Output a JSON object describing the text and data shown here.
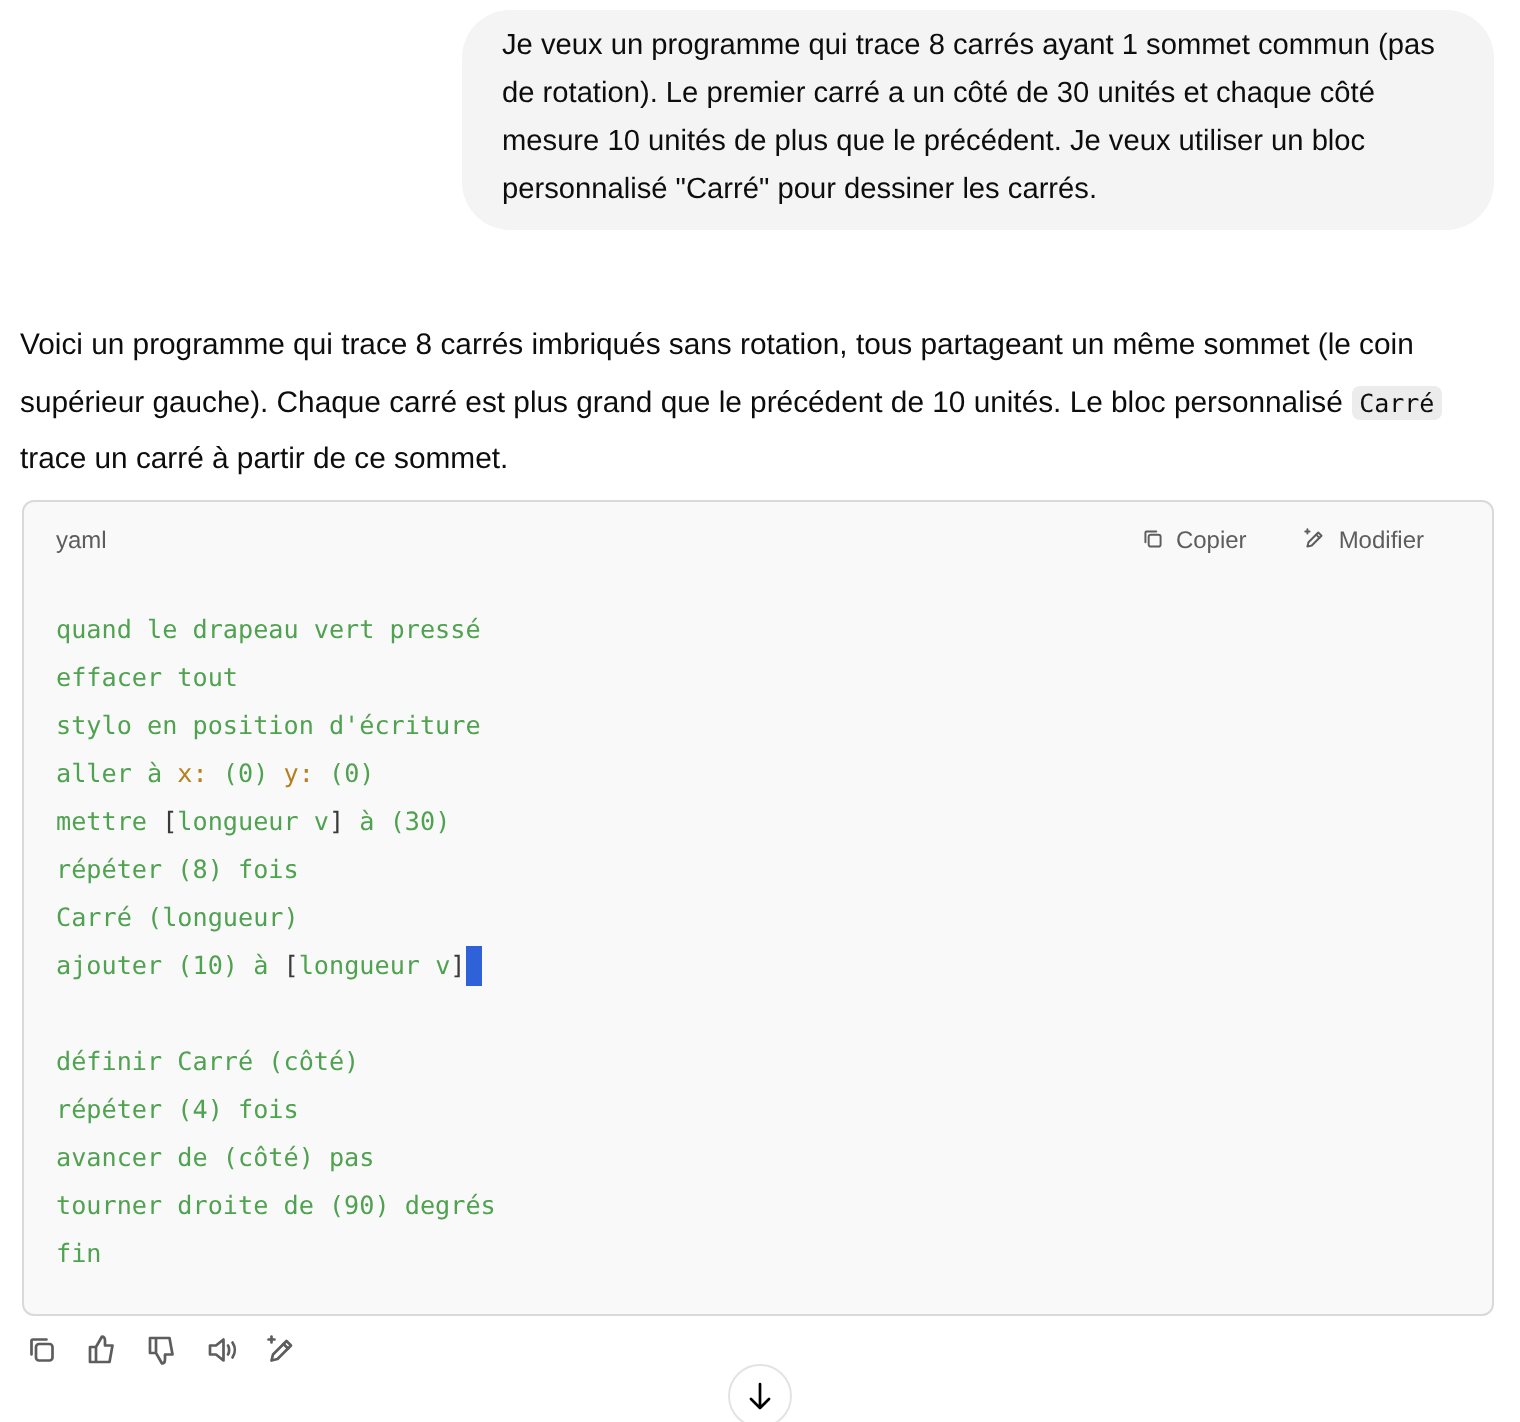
{
  "user_message": {
    "text": "Je veux un programme qui trace 8 carrés ayant 1 sommet commun (pas de rotation). Le premier carré a un côté de 30 unités et chaque côté mesure 10 unités de plus que le précédent. Je veux utiliser un bloc personnalisé \"Carré\" pour dessiner les carrés."
  },
  "reply": {
    "paragraph": [
      {
        "kind": "text",
        "text": "Voici un programme qui trace 8 carrés imbriqués sans rotation, tous partageant un même sommet (le coin supérieur gauche). Chaque carré est plus grand que le précédent de 10 unités. Le bloc personnalisé "
      },
      {
        "kind": "code",
        "text": "Carré"
      },
      {
        "kind": "text",
        "text": " trace un carré à partir de ce sommet."
      }
    ],
    "code_block": {
      "language": "yaml",
      "actions": [
        {
          "kind": "copy",
          "label": "Copier"
        },
        {
          "kind": "edit",
          "label": "Modifier"
        }
      ],
      "lines": [
        {
          "kind": "code",
          "segments": [
            {
              "kind": "text",
              "text": "quand le drapeau vert pressé"
            }
          ]
        },
        {
          "kind": "code",
          "segments": [
            {
              "kind": "text",
              "text": "effacer tout"
            }
          ]
        },
        {
          "kind": "code",
          "segments": [
            {
              "kind": "text",
              "text": "stylo en position d'écriture"
            }
          ]
        },
        {
          "kind": "code",
          "segments": [
            {
              "kind": "text",
              "text": "aller à "
            },
            {
              "kind": "attr",
              "text": "x:"
            },
            {
              "kind": "text",
              "text": " (0) "
            },
            {
              "kind": "attr",
              "text": "y:"
            },
            {
              "kind": "text",
              "text": " (0)"
            }
          ]
        },
        {
          "kind": "code",
          "segments": [
            {
              "kind": "text",
              "text": "mettre "
            },
            {
              "kind": "bracket",
              "text": "["
            },
            {
              "kind": "text",
              "text": "longueur v"
            },
            {
              "kind": "bracket",
              "text": "]"
            },
            {
              "kind": "text",
              "text": " à (30)"
            }
          ]
        },
        {
          "kind": "code",
          "segments": [
            {
              "kind": "text",
              "text": "répéter (8) fois"
            }
          ]
        },
        {
          "kind": "code",
          "segments": [
            {
              "kind": "text",
              "text": "Carré (longueur)"
            }
          ]
        },
        {
          "kind": "code",
          "cursor": true,
          "segments": [
            {
              "kind": "text",
              "text": "ajouter (10) à "
            },
            {
              "kind": "bracket",
              "text": "["
            },
            {
              "kind": "text",
              "text": "longueur v"
            },
            {
              "kind": "bracket",
              "text": "]"
            }
          ]
        },
        {
          "kind": "blank"
        },
        {
          "kind": "code",
          "segments": [
            {
              "kind": "text",
              "text": "définir Carré (côté)"
            }
          ]
        },
        {
          "kind": "code",
          "segments": [
            {
              "kind": "text",
              "text": "répéter (4) fois"
            }
          ]
        },
        {
          "kind": "code",
          "segments": [
            {
              "kind": "text",
              "text": "avancer de (côté) pas"
            }
          ]
        },
        {
          "kind": "code",
          "segments": [
            {
              "kind": "text",
              "text": "tourner droite de (90) degrés"
            }
          ]
        },
        {
          "kind": "code",
          "segments": [
            {
              "kind": "text",
              "text": "fin"
            }
          ]
        }
      ]
    },
    "message_actions": [
      {
        "kind": "copy"
      },
      {
        "kind": "like"
      },
      {
        "kind": "dislike"
      },
      {
        "kind": "read_aloud"
      },
      {
        "kind": "edit"
      }
    ]
  },
  "scroll_button": {
    "kind": "down"
  }
}
